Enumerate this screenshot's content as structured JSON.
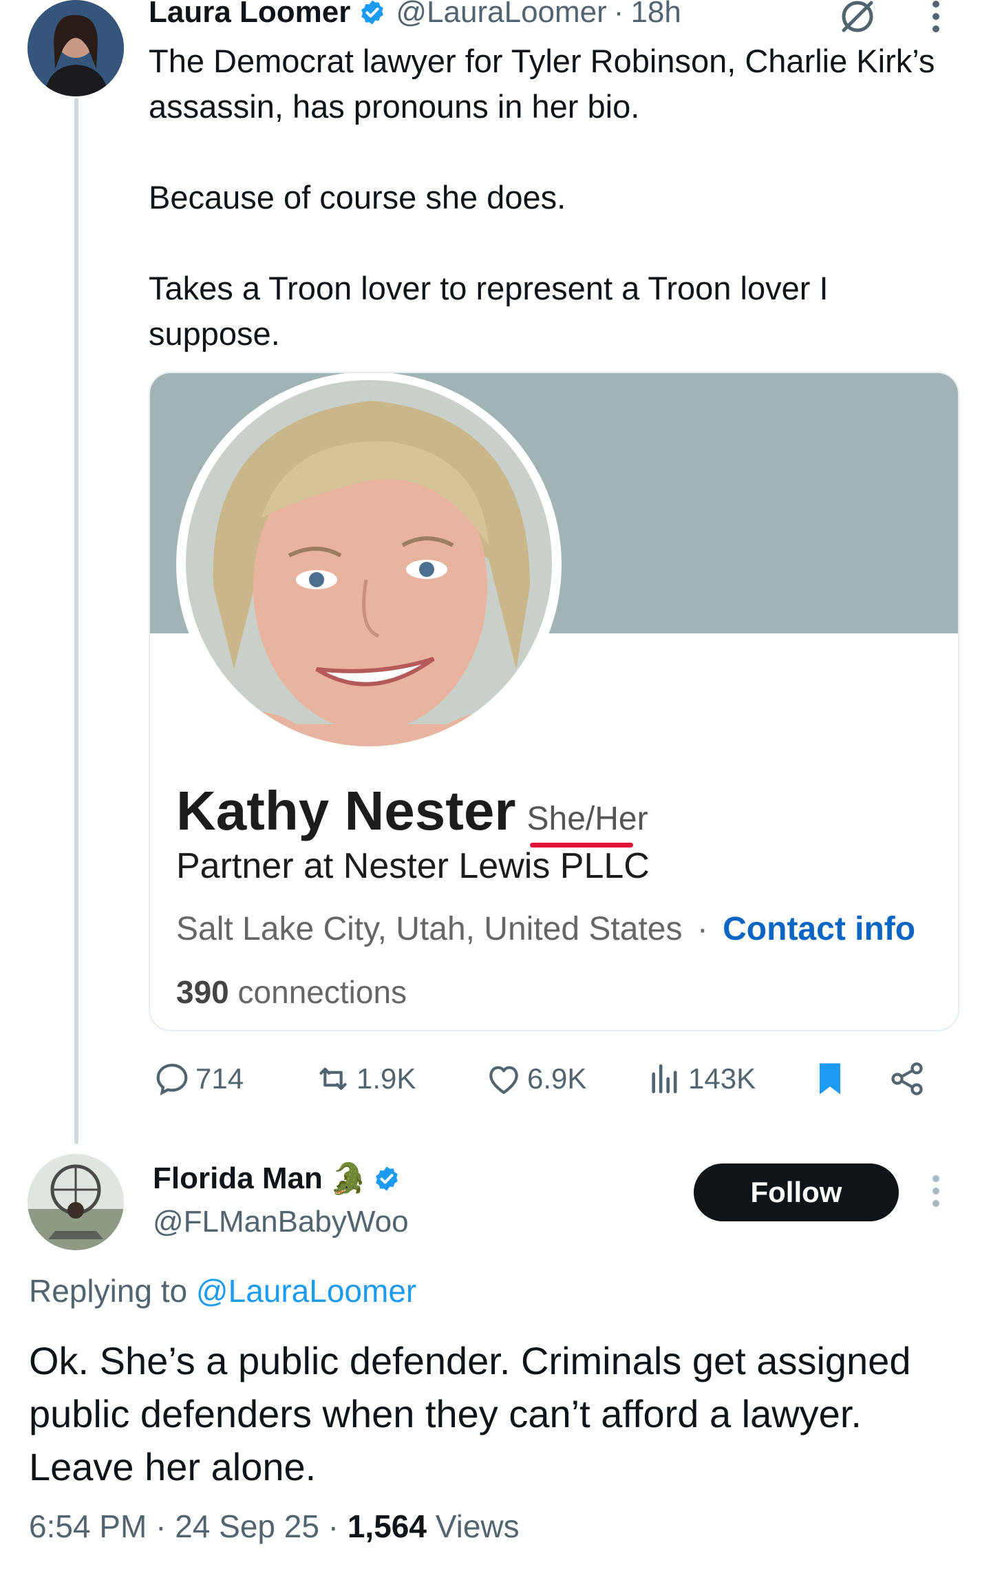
{
  "tweet": {
    "author_name": "Laura Loomer",
    "author_handle": "@LauraLoomer",
    "time": "18h",
    "separator": "·",
    "text": "The Democrat lawyer for Tyler Robinson, Charlie Kirk’s assassin, has pronouns in her bio.\n\nBecause of course she does.\n\nTakes a Troon lover to represent a Troon lover I suppose.",
    "image_card": {
      "name": "Kathy Nester",
      "pronouns": "She/Her",
      "headline": "Partner at Nester Lewis PLLC",
      "location": "Salt Lake City, Utah, United States",
      "dot": "·",
      "contact": "Contact info",
      "connections_count": "390",
      "connections_label": "connections",
      "banner_color": "#a2b3b6",
      "link_color": "#0a66c2",
      "underline_color": "#e0103a"
    },
    "stats": {
      "replies": "714",
      "reposts": "1.9K",
      "likes": "6.9K",
      "views": "143K"
    },
    "icons": [
      "grok-icon",
      "more-icon",
      "reply-icon",
      "repost-icon",
      "like-icon",
      "views-icon",
      "bookmark-icon",
      "share-icon"
    ]
  },
  "reply": {
    "author_name": "Florida Man",
    "emoji": "🐊",
    "author_handle": "@FLManBabyWoo",
    "follow_label": "Follow",
    "replying_to_prefix": "Replying to",
    "replying_to_handle": "@LauraLoomer",
    "text": "Ok. She’s a public defender. Criminals get assigned public defenders when they can’t afford a lawyer. Leave her alone.",
    "time": "6:54 PM",
    "date": "24 Sep 25",
    "views_count": "1,564",
    "views_label": "Views",
    "separator": "·"
  },
  "colors": {
    "accent": "#1d9bf0",
    "text": "#0f1419",
    "muted": "#536471",
    "thread_line": "#cfd9de"
  }
}
